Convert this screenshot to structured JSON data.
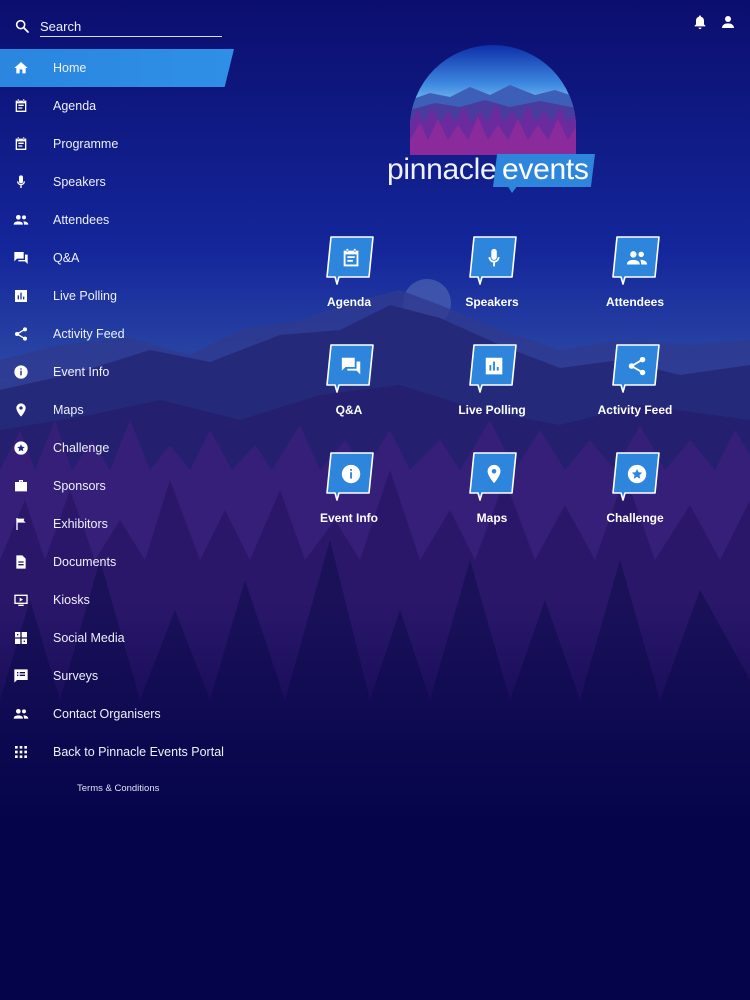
{
  "search": {
    "placeholder": "Search"
  },
  "header": {
    "icons": [
      "bell-icon",
      "user-icon"
    ]
  },
  "sidebar": {
    "items": [
      {
        "label": "Home",
        "icon": "home-icon",
        "active": true
      },
      {
        "label": "Agenda",
        "icon": "calendar-icon"
      },
      {
        "label": "Programme",
        "icon": "calendar-icon"
      },
      {
        "label": "Speakers",
        "icon": "microphone-icon"
      },
      {
        "label": "Attendees",
        "icon": "people-icon"
      },
      {
        "label": "Q&A",
        "icon": "chat-icon"
      },
      {
        "label": "Live Polling",
        "icon": "bar-chart-icon"
      },
      {
        "label": "Activity Feed",
        "icon": "share-icon"
      },
      {
        "label": "Event Info",
        "icon": "info-icon"
      },
      {
        "label": "Maps",
        "icon": "map-pin-icon"
      },
      {
        "label": "Challenge",
        "icon": "star-badge-icon"
      },
      {
        "label": "Sponsors",
        "icon": "briefcase-icon"
      },
      {
        "label": "Exhibitors",
        "icon": "flag-icon"
      },
      {
        "label": "Documents",
        "icon": "document-icon"
      },
      {
        "label": "Kiosks",
        "icon": "screen-icon"
      },
      {
        "label": "Social Media",
        "icon": "social-icon"
      },
      {
        "label": "Surveys",
        "icon": "survey-icon"
      },
      {
        "label": "Contact Organisers",
        "icon": "people-icon"
      },
      {
        "label": "Back to Pinnacle Events Portal",
        "icon": "grid-icon"
      }
    ],
    "terms": "Terms & Conditions"
  },
  "logo": {
    "word1": "pinnacle",
    "word2": "events"
  },
  "tiles": [
    {
      "label": "Agenda",
      "icon": "calendar-icon"
    },
    {
      "label": "Speakers",
      "icon": "microphone-icon"
    },
    {
      "label": "Attendees",
      "icon": "people-icon"
    },
    {
      "label": "Q&A",
      "icon": "chat-icon"
    },
    {
      "label": "Live Polling",
      "icon": "bar-chart-icon"
    },
    {
      "label": "Activity Feed",
      "icon": "share-icon"
    },
    {
      "label": "Event Info",
      "icon": "info-icon"
    },
    {
      "label": "Maps",
      "icon": "map-pin-icon"
    },
    {
      "label": "Challenge",
      "icon": "star-badge-icon"
    }
  ],
  "colors": {
    "accent": "#2d86dc",
    "background_top": "#101d8a",
    "background_bottom": "#05044a"
  }
}
